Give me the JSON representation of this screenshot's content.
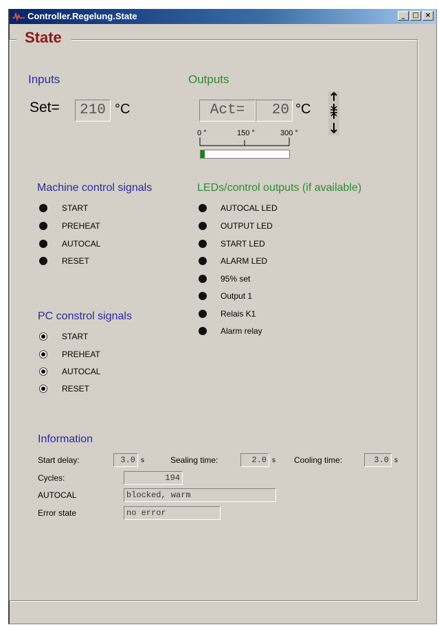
{
  "window": {
    "title": "Controller.Regelung.State",
    "buttons": {
      "minimize": "_",
      "maximize": "□",
      "close": "×"
    }
  },
  "group_title": "State",
  "inputs": {
    "heading": "Inputs",
    "set_label": "Set=",
    "set_value": "210",
    "unit": "°C"
  },
  "outputs": {
    "heading": "Outputs",
    "act_label": "Act=",
    "act_value": "20",
    "unit": "°C",
    "scale_labels": [
      "0 °",
      "150 °",
      "300 °"
    ],
    "bar_fill_fraction": 0.05,
    "bar_color": "#118811"
  },
  "machine_signals": {
    "heading": "Machine control signals",
    "items": [
      "START",
      "PREHEAT",
      "AUTOCAL",
      "RESET"
    ]
  },
  "led_outputs": {
    "heading": "LEDs/control outputs (if available)",
    "items": [
      "AUTOCAL LED",
      "OUTPUT LED",
      "START LED",
      "ALARM LED",
      "95% set",
      "Output 1",
      "Relais K1",
      "Alarm relay"
    ]
  },
  "pc_signals": {
    "heading": "PC constrol signals",
    "items": [
      "START",
      "PREHEAT",
      "AUTOCAL",
      "RESET"
    ]
  },
  "information": {
    "heading": "Information",
    "start_delay_label": "Start delay:",
    "start_delay_value": "3.0",
    "sealing_time_label": "Sealing time:",
    "sealing_time_value": "2.0",
    "cooling_time_label": "Cooling time:",
    "cooling_time_value": "3.0",
    "seconds_unit": "s",
    "cycles_label": "Cycles:",
    "cycles_value": "194",
    "autocal_label": "AUTOCAL",
    "autocal_value": "blocked, warm",
    "error_label": "Error state",
    "error_value": "no error"
  }
}
